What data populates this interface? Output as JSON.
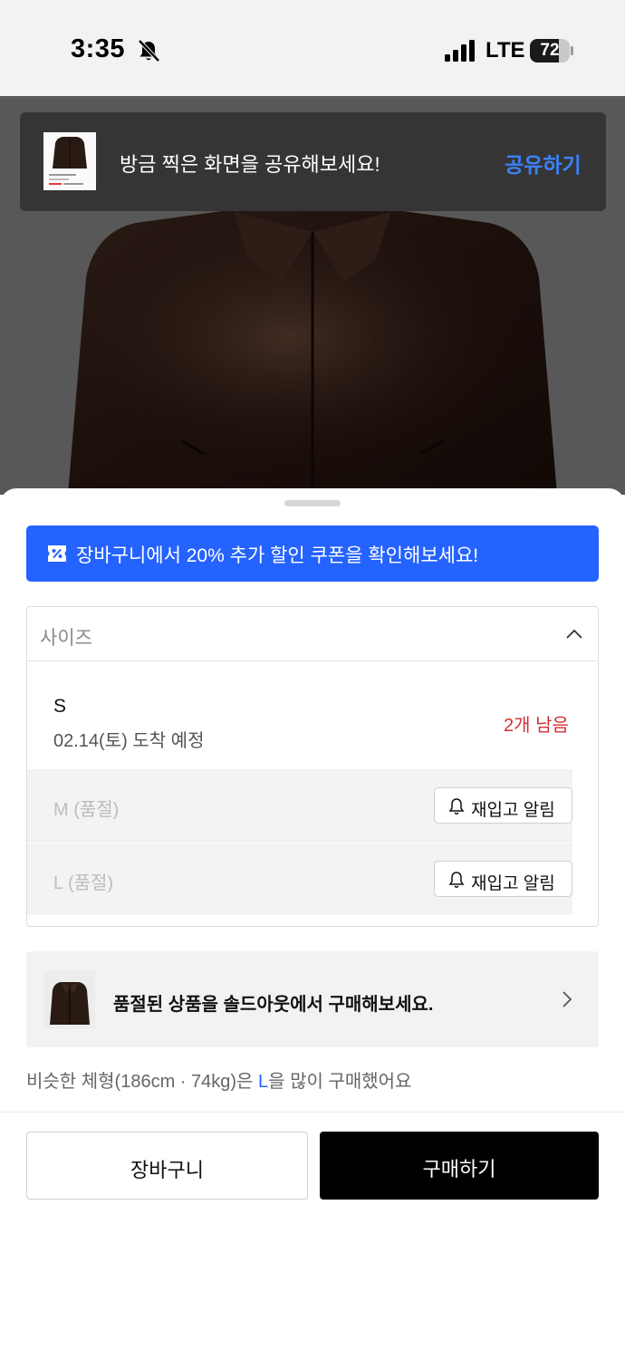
{
  "status_bar": {
    "time": "3:35",
    "network": "LTE",
    "battery": "72",
    "battery_level_percent": 72,
    "icons": [
      "bell-slash-icon",
      "cellular-signal-icon",
      "battery-icon"
    ]
  },
  "share_toast": {
    "message": "방금 찍은 화면을 공유해보세요!",
    "action": "공유하기",
    "accent_color": "#3b82f6"
  },
  "coupon_banner": {
    "text": "장바구니에서 20% 추가 할인 쿠폰을 확인해보세요!",
    "icon": "coupon-icon",
    "color": "#2563ff"
  },
  "size_selector": {
    "label": "사이즈",
    "expanded": true,
    "options": [
      {
        "name": "S",
        "delivery": "02.14(토) 도착 예정",
        "stock": "2개 남음",
        "sold_out": false
      },
      {
        "name": "M (품절)",
        "restock_label": "재입고 알림",
        "sold_out": true
      },
      {
        "name": "L (품절)",
        "restock_label": "재입고 알림",
        "sold_out": true
      }
    ]
  },
  "soldout_banner": {
    "text": "품절된 상품을 솔드아웃에서 구매해보세요."
  },
  "body_size_hint": {
    "prefix": "비슷한 체형(186cm · 74kg)은 ",
    "highlight": "L",
    "suffix": "을 많이 구매했어요"
  },
  "actions": {
    "cart": "장바구니",
    "buy": "구매하기"
  }
}
